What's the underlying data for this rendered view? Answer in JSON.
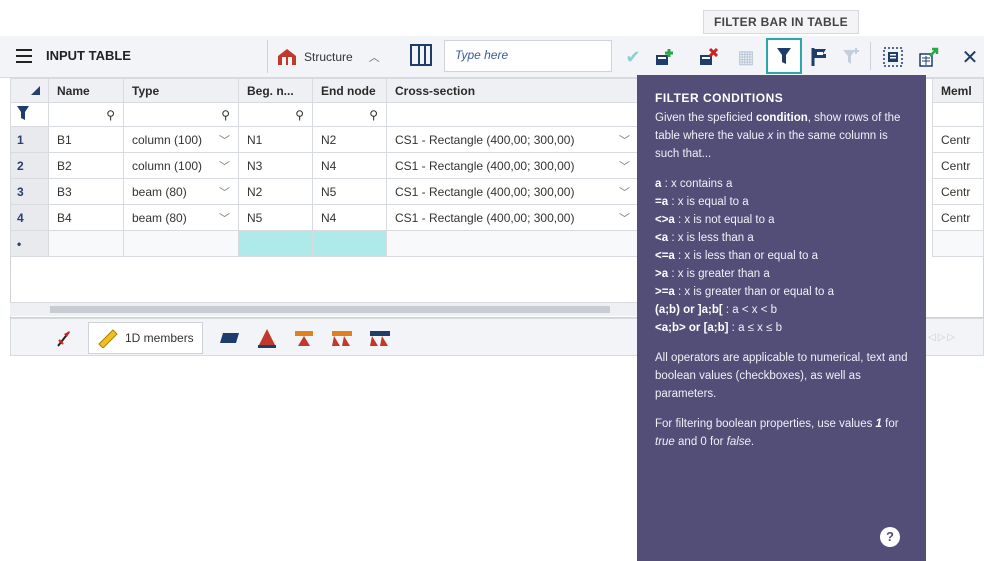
{
  "top_tooltip": "FILTER BAR IN TABLE",
  "toolbar": {
    "title": "INPUT TABLE",
    "structure_label": "Structure",
    "search_placeholder": "Type here"
  },
  "table": {
    "headers": [
      "Name",
      "Type",
      "Beg. n...",
      "End node",
      "Cross-section"
    ],
    "right_header": "Meml",
    "rows": [
      {
        "idx": "1",
        "name": "B1",
        "type": "column (100)",
        "beg": "N1",
        "end": "N2",
        "cs": "CS1 - Rectangle (400,00; 300,00)",
        "right": "Centr"
      },
      {
        "idx": "2",
        "name": "B2",
        "type": "column (100)",
        "beg": "N3",
        "end": "N4",
        "cs": "CS1 - Rectangle (400,00; 300,00)",
        "right": "Centr"
      },
      {
        "idx": "3",
        "name": "B3",
        "type": "beam (80)",
        "beg": "N2",
        "end": "N5",
        "cs": "CS1 - Rectangle (400,00; 300,00)",
        "right": "Centr"
      },
      {
        "idx": "4",
        "name": "B4",
        "type": "beam (80)",
        "beg": "N5",
        "end": "N4",
        "cs": "CS1 - Rectangle (400,00; 300,00)",
        "right": "Centr"
      }
    ],
    "new_row_marker": "•"
  },
  "tabs": {
    "members_label": "1D members"
  },
  "tooltip": {
    "title": "FILTER CONDITIONS",
    "intro_1": "Given the speficied ",
    "intro_bold": "condition",
    "intro_2": ", show rows of the table where the value ",
    "intro_x": "x",
    "intro_3": " in the same column is such that...",
    "ops": [
      {
        "op": "a",
        "desc": " : x contains a"
      },
      {
        "op": "=a",
        "desc": " : x is equal to a"
      },
      {
        "op": "<>a",
        "desc": " : x is not equal to a"
      },
      {
        "op": "<a",
        "desc": " : x is less than a"
      },
      {
        "op": "<=a",
        "desc": " : x is less than or equal to a"
      },
      {
        "op": ">a",
        "desc": " : x is greater than a"
      },
      {
        "op": ">=a",
        "desc": " : x is greater than or equal to a"
      },
      {
        "op": "(a;b) or ]a;b[",
        "desc": " : a < x < b"
      },
      {
        "op": "<a;b> or [a;b]",
        "desc": " : a ≤ x ≤ b"
      }
    ],
    "note_1": "All operators are applicable to numerical, text and boolean values (checkboxes), as well as parameters.",
    "note_2a": "For filtering boolean properties, use values ",
    "note_2_one": "1",
    "note_2b": " for ",
    "note_2_true": "true",
    "note_2c": " and 0 for ",
    "note_2_false": "false",
    "note_2d": ".",
    "help": "?"
  }
}
